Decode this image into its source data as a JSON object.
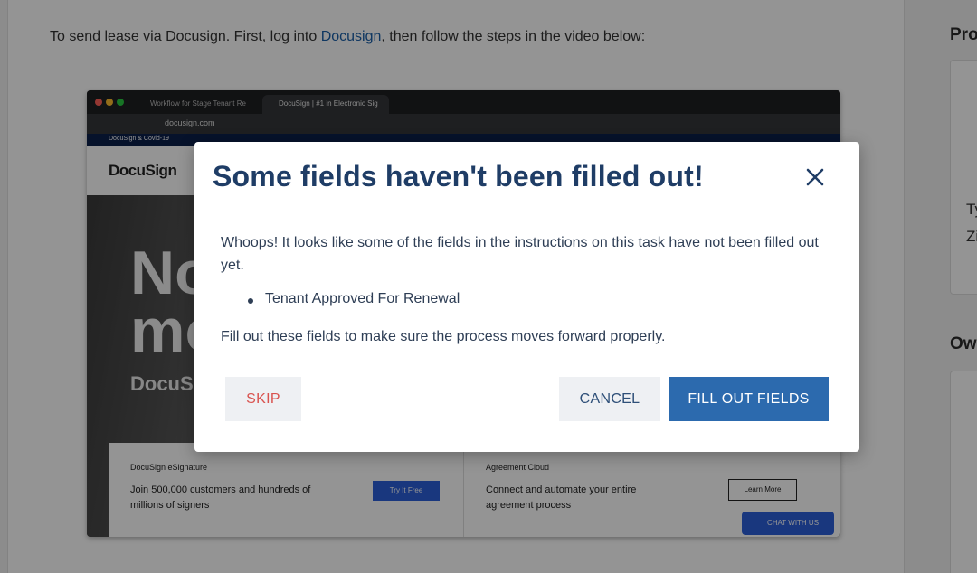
{
  "background": {
    "intro_prefix": "To send lease via Docusign. First, log into ",
    "intro_link": "Docusign",
    "intro_suffix": ", then follow the steps in the video below:",
    "right_col": {
      "heading1": "Pro",
      "text1": "Ty",
      "text2": "Zi",
      "heading2": "Ow"
    }
  },
  "video": {
    "tab1": "Workflow for Stage Tenant Re",
    "tab2": "DocuSign | #1 in Electronic Sig",
    "url": "docusign.com",
    "banner": "DocuSign & Covid-19",
    "logo": "DocuSign",
    "hero_line1": "No",
    "hero_line2": "mo",
    "hero_brand": "DocuSig",
    "card1": {
      "title": "DocuSign eSignature",
      "body": "Join 500,000 customers and hundreds of millions of signers",
      "button": "Try It Free"
    },
    "card2": {
      "title": "Agreement Cloud",
      "body": "Connect and automate your entire agreement process",
      "button": "Learn More"
    },
    "chat": "CHAT WITH US"
  },
  "modal": {
    "title": "Some fields haven't been filled out!",
    "message": "Whoops! It looks like some of the fields in the instructions on this task have not been filled out yet.",
    "missing_fields": [
      "Tenant Approved For Renewal"
    ],
    "footer": "Fill out these fields to make sure the process moves forward properly.",
    "skip_label": "SKIP",
    "cancel_label": "CANCEL",
    "fill_label": "FILL OUT FIELDS"
  },
  "colors": {
    "title": "#1f3d66",
    "primary": "#2c6aae",
    "danger": "#d9534f"
  }
}
